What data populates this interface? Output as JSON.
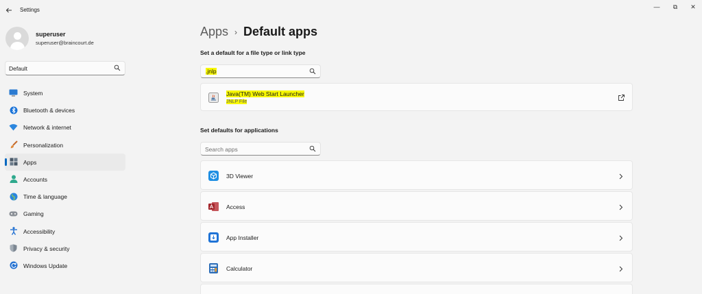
{
  "window": {
    "title": "Settings",
    "controls": {
      "minimize": "—",
      "restore": "⧉",
      "close": "✕"
    }
  },
  "user": {
    "name": "superuser",
    "email": "superuser@braincourt.de"
  },
  "sidebar": {
    "search_value": "Default",
    "items": [
      {
        "label": "System",
        "icon": "system-icon",
        "active": false
      },
      {
        "label": "Bluetooth & devices",
        "icon": "bluetooth-icon",
        "active": false
      },
      {
        "label": "Network & internet",
        "icon": "wifi-icon",
        "active": false
      },
      {
        "label": "Personalization",
        "icon": "brush-icon",
        "active": false
      },
      {
        "label": "Apps",
        "icon": "apps-icon",
        "active": true
      },
      {
        "label": "Accounts",
        "icon": "accounts-icon",
        "active": false
      },
      {
        "label": "Time & language",
        "icon": "globe-icon",
        "active": false
      },
      {
        "label": "Gaming",
        "icon": "gamepad-icon",
        "active": false
      },
      {
        "label": "Accessibility",
        "icon": "accessibility-icon",
        "active": false
      },
      {
        "label": "Privacy & security",
        "icon": "shield-icon",
        "active": false
      },
      {
        "label": "Windows Update",
        "icon": "update-icon",
        "active": false
      }
    ]
  },
  "main": {
    "breadcrumb": {
      "parent": "Apps",
      "separator": "›",
      "current": "Default apps"
    },
    "filetype_section": {
      "title": "Set a default for a file type or link type",
      "search_value": ".jnlp",
      "result": {
        "title": "Java(TM) Web Start Launcher",
        "subtitle": "JNLP File",
        "icon": "java-icon",
        "action_icon": "open-external-icon"
      }
    },
    "apps_section": {
      "title": "Set defaults for applications",
      "search_placeholder": "Search apps",
      "apps": [
        {
          "label": "3D Viewer",
          "icon": "3d-viewer-icon"
        },
        {
          "label": "Access",
          "icon": "access-icon"
        },
        {
          "label": "App Installer",
          "icon": "app-installer-icon"
        },
        {
          "label": "Calculator",
          "icon": "calculator-icon"
        }
      ]
    }
  },
  "colors": {
    "accent": "#0067c0",
    "highlight": "#f7f700",
    "background": "#f3f3f3",
    "card": "#fbfbfb"
  }
}
